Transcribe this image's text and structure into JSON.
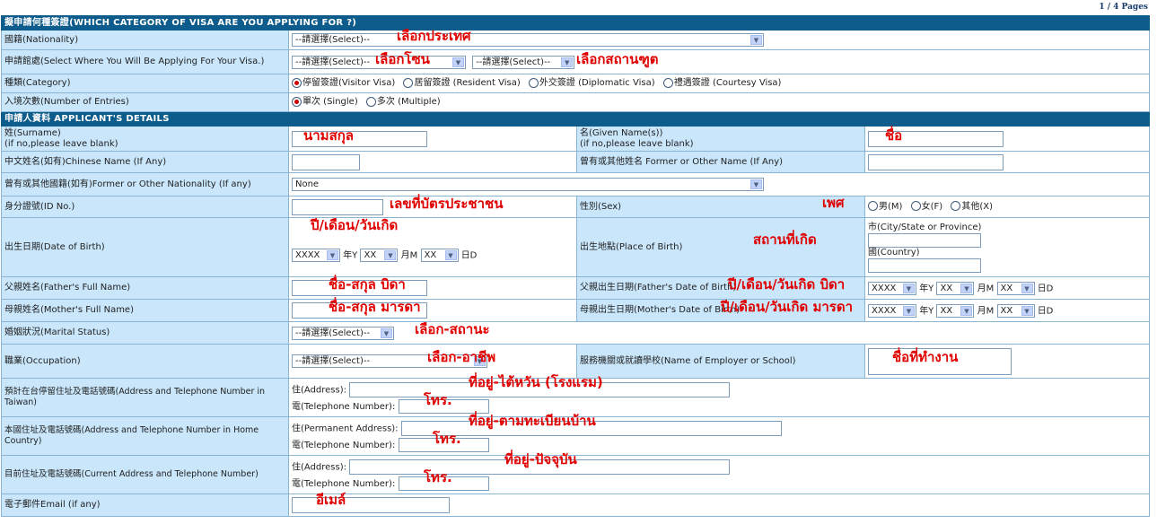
{
  "page_indicator": "1 / 4 Pages",
  "sections": {
    "visa_category": "擬申請何種簽證(WHICH CATEGORY OF VISA ARE YOU APPLYING FOR ?)",
    "applicant": "申請人資料 APPLICANT'S DETAILS"
  },
  "nationality": {
    "label": "國籍(Nationality)",
    "select": "--請選擇(Select)--",
    "note": "เลือกประเทศ"
  },
  "apply_where": {
    "label": "申請館處(Select Where You Will Be Applying For Your Visa.)",
    "select1": "--請選擇(Select)--",
    "note1": "เลือกโซน",
    "select2": "--請選擇(Select)--",
    "note2": "เลือกสถานฑูต"
  },
  "category": {
    "label": "種類(Category)",
    "options": [
      "停留簽證(Visitor Visa)",
      "居留簽證 (Resident Visa)",
      "外交簽證 (Diplomatic Visa)",
      "禮遇簽證 (Courtesy Visa)"
    ],
    "selected_index": 0
  },
  "entries": {
    "label": "入境次數(Number of Entries)",
    "options": [
      "單次 (Single)",
      "多次 (Multiple)"
    ],
    "selected_index": 0
  },
  "surname": {
    "label1": "姓(Surname)",
    "label2": "(if no,please leave blank)",
    "note": "นามสกุล"
  },
  "given_name": {
    "label1": "名(Given Name(s))",
    "label2": "(if no,please leave blank)",
    "note": "ชื่อ"
  },
  "chinese_name": {
    "label": "中文姓名(如有)Chinese Name (If Any)"
  },
  "former_name": {
    "label": "曾有或其他姓名 Former or Other Name (If Any)"
  },
  "former_nationality": {
    "label": "曾有或其他國籍(如有)Former or Other Nationality (If any)",
    "select": "None"
  },
  "id_no": {
    "label": "身分證號(ID No.)",
    "note": "เลขที่บัตรประชาชน"
  },
  "sex": {
    "label": "性別(Sex)",
    "note": "เพศ",
    "options": [
      "男(M)",
      "女(F)",
      "其他(X)"
    ]
  },
  "dob": {
    "label": "出生日期(Date of Birth)",
    "note": "ปี/เดือน/วันเกิด",
    "year": "XXXX",
    "year_unit": "年Y",
    "month": "XX",
    "month_unit": "月M",
    "day": "XX",
    "day_unit": "日D"
  },
  "pob": {
    "label": "出生地點(Place of Birth)",
    "note": "สถานที่เกิด",
    "city_label": "市(City/State or Province)",
    "country_label": "國(Country)"
  },
  "father_name": {
    "label": "父親姓名(Father's Full Name)",
    "note": "ชื่อ-สกุล บิดา"
  },
  "father_dob": {
    "label": "父親出生日期(Father's Date of Birth)",
    "note": "ปี/เดือน/วันเกิด บิดา",
    "year": "XXXX",
    "year_unit": "年Y",
    "month": "XX",
    "month_unit": "月M",
    "day": "XX",
    "day_unit": "日D"
  },
  "mother_name": {
    "label": "母親姓名(Mother's Full Name)",
    "note": "ชื่อ-สกุล มารดา"
  },
  "mother_dob": {
    "label": "母親出生日期(Mother's Date of Birth)",
    "note": "ปี/เดือน/วันเกิด มารดา",
    "year": "XXXX",
    "year_unit": "年Y",
    "month": "XX",
    "month_unit": "月M",
    "day": "XX",
    "day_unit": "日D"
  },
  "marital": {
    "label": "婚姻狀況(Marital Status)",
    "select": "--請選擇(Select)--",
    "note": "เลือก-สถานะ"
  },
  "occupation": {
    "label": "職業(Occupation)",
    "select": "--請選擇(Select)--",
    "note": "เลือก-อาชีพ"
  },
  "employer": {
    "label": "服務機關或就讀學校(Name of Employer or School)",
    "note": "ชื่อที่ทำงาน"
  },
  "taiwan_address": {
    "label": "預計在台停留住址及電話號碼(Address and Telephone Number in Taiwan)",
    "addr_label": "住(Address):",
    "addr_note": "ที่อยู่-ไต้หวัน (โรงแรม)",
    "tel_label": "電(Telephone Number):",
    "tel_note": "โทร."
  },
  "home_address": {
    "label": "本國住址及電話號碼(Address and Telephone Number in Home Country)",
    "addr_label": "住(Permanent Address):",
    "addr_note": "ที่อยู่-ตามทะเบียนบ้าน",
    "tel_label": "電(Telephone Number):",
    "tel_note": "โทร."
  },
  "current_address": {
    "label": "目前住址及電話號碼(Current Address and Telephone Number)",
    "addr_label": "住(Address):",
    "addr_note": "ที่อยู่-ปัจจุบัน",
    "tel_label": "電(Telephone Number):",
    "tel_note": "โทร."
  },
  "email": {
    "label": "電子郵件Email (if any)",
    "note": "อีเมล์"
  },
  "colors": {
    "header": "#0d5c8c",
    "label_bg": "#c9e6fb",
    "annotation": "#e00000"
  }
}
